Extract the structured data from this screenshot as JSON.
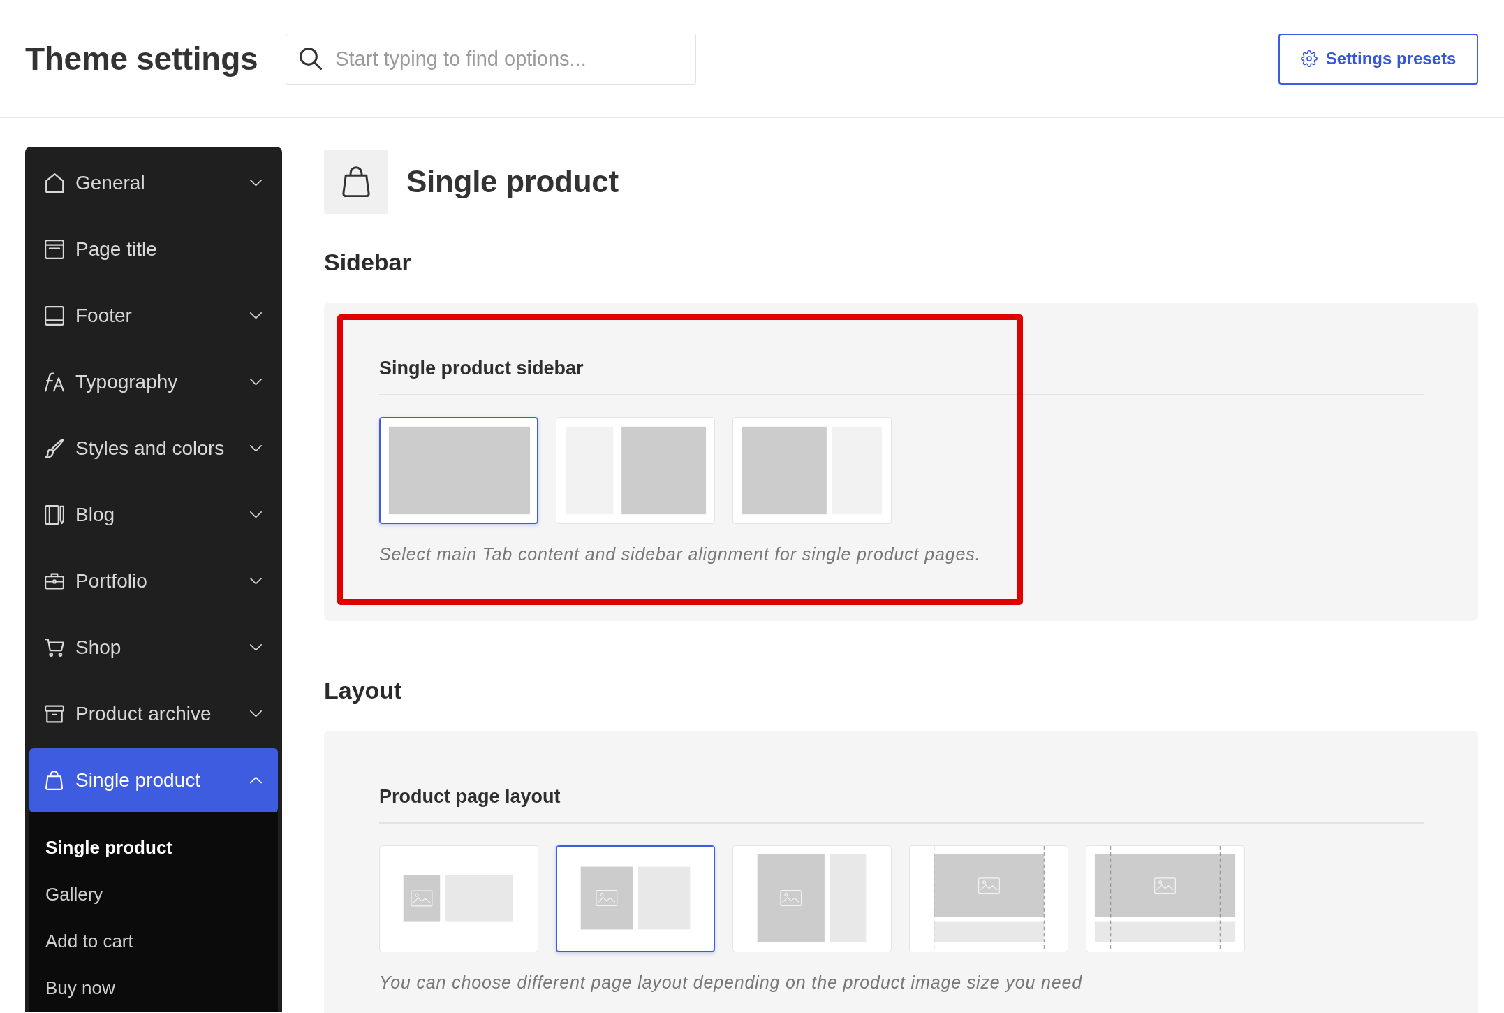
{
  "header": {
    "title": "Theme settings",
    "search": {
      "placeholder": "Start typing to find options..."
    },
    "presets_button": {
      "label": "Settings presets"
    }
  },
  "sidebar": {
    "items": [
      {
        "label": "General",
        "selected": false,
        "expanded": false
      },
      {
        "label": "Page title",
        "selected": false
      },
      {
        "label": "Footer",
        "selected": false,
        "expanded": false
      },
      {
        "label": "Typography",
        "selected": false,
        "expanded": false
      },
      {
        "label": "Styles and colors",
        "selected": false,
        "expanded": false
      },
      {
        "label": "Blog",
        "selected": false,
        "expanded": false
      },
      {
        "label": "Portfolio",
        "selected": false,
        "expanded": false
      },
      {
        "label": "Shop",
        "selected": false,
        "expanded": false
      },
      {
        "label": "Product archive",
        "selected": false,
        "expanded": false
      },
      {
        "label": "Single product",
        "selected": true,
        "expanded": true,
        "children": [
          {
            "label": "Single product",
            "selected": true
          },
          {
            "label": "Gallery",
            "selected": false
          },
          {
            "label": "Add to cart",
            "selected": false
          },
          {
            "label": "Buy now",
            "selected": false
          }
        ]
      }
    ]
  },
  "page": {
    "title": "Single product"
  },
  "sections": [
    {
      "heading": "Sidebar",
      "fields": [
        {
          "label": "Single product sidebar",
          "highlighted": true,
          "options": [
            {
              "kind": "full",
              "selected": true
            },
            {
              "kind": "left-sidebar",
              "selected": false
            },
            {
              "kind": "right-sidebar",
              "selected": false
            }
          ],
          "description": "Select main Tab content and sidebar alignment for single product pages."
        }
      ]
    },
    {
      "heading": "Layout",
      "fields": [
        {
          "label": "Product page layout",
          "highlighted": false,
          "options": [
            {
              "kind": "small-image",
              "selected": false
            },
            {
              "kind": "medium-image",
              "selected": true
            },
            {
              "kind": "tall-image",
              "selected": false
            },
            {
              "kind": "wide-image",
              "selected": false
            },
            {
              "kind": "full-width-image",
              "selected": false
            }
          ],
          "description": "You can choose different page layout depending on the product image size you need"
        }
      ]
    }
  ]
}
